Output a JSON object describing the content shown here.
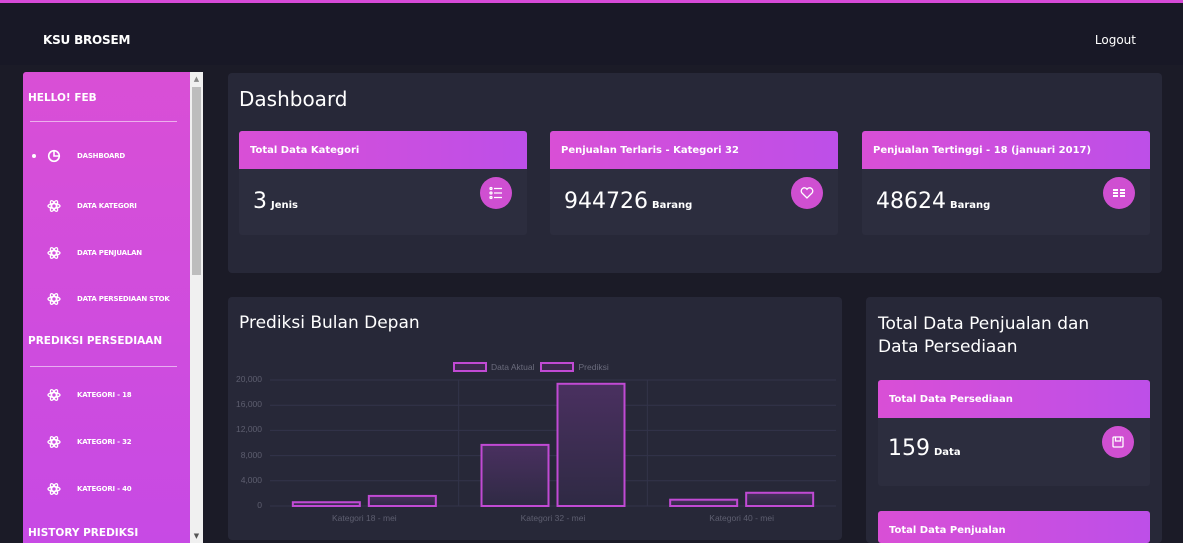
{
  "header": {
    "brand": "KSU BROSEM",
    "logout_label": "Logout"
  },
  "sidebar": {
    "greeting": "HELLO! FEB",
    "section_prediksi": "PREDIKSI PERSEDIAAN",
    "section_history": "HISTORY PREDIKSI",
    "items": [
      {
        "label": "DASHBOARD",
        "icon": "pie-chart-icon",
        "active": true
      },
      {
        "label": "DATA KATEGORI",
        "icon": "atom-icon"
      },
      {
        "label": "DATA PENJUALAN",
        "icon": "atom-icon"
      },
      {
        "label": "DATA PERSEDIAAN STOK",
        "icon": "atom-icon"
      }
    ],
    "prediksi_items": [
      {
        "label": "KATEGORI - 18",
        "icon": "atom-icon"
      },
      {
        "label": "KATEGORI - 32",
        "icon": "atom-icon"
      },
      {
        "label": "KATEGORI - 40",
        "icon": "atom-icon"
      }
    ]
  },
  "dashboard": {
    "title": "Dashboard",
    "cards": [
      {
        "header": "Total Data Kategori",
        "value": "3",
        "unit": "Jenis",
        "icon": "list-icon"
      },
      {
        "header": "Penjualan Terlaris - Kategori 32",
        "value": "944726",
        "unit": "Barang",
        "icon": "heart-icon"
      },
      {
        "header": "Penjualan Tertinggi - 18 (januari 2017)",
        "value": "48624",
        "unit": "Barang",
        "icon": "money-icon"
      }
    ]
  },
  "prediksi": {
    "title": "Prediksi Bulan Depan"
  },
  "totals": {
    "title_line1": "Total Data Penjualan dan",
    "title_line2": "Data Persediaan",
    "cards": [
      {
        "header": "Total Data Persediaan",
        "value": "159",
        "unit": "Data",
        "icon": "save-icon"
      },
      {
        "header": "Total Data Penjualan"
      }
    ]
  },
  "colors": {
    "accent": "#d64ad8",
    "bar_fill": "#3b2a4d",
    "bar_border": "#c14ad4",
    "panel": "#272838"
  },
  "chart_data": {
    "type": "bar",
    "categories": [
      "Kategori 18 - mei",
      "Kategori 32 - mei",
      "Kategori 40 - mei"
    ],
    "series": [
      {
        "name": "Data Aktual",
        "values": [
          600,
          9700,
          1000
        ]
      },
      {
        "name": "Prediksi",
        "values": [
          1600,
          19400,
          2100
        ]
      }
    ],
    "yticks": [
      "20,000",
      "16,000",
      "12,000",
      "8,000",
      "4,000",
      "0"
    ],
    "ylim": [
      0,
      20000
    ],
    "legend": "top-center",
    "grid": true
  }
}
